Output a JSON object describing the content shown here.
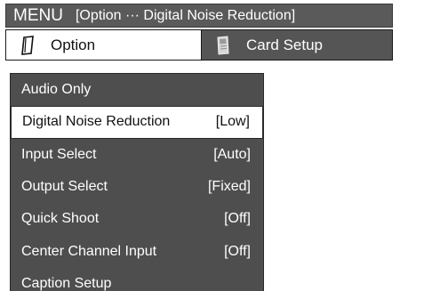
{
  "header": {
    "menu_label": "MENU",
    "breadcrumb": "[Option ··· Digital Noise Reduction]"
  },
  "tabs": [
    {
      "label": "Option",
      "icon": "option-icon",
      "active": true
    },
    {
      "label": "Card Setup",
      "icon": "card-icon",
      "active": false
    }
  ],
  "menu": {
    "items": [
      {
        "label": "Audio Only",
        "value": ""
      },
      {
        "label": "Digital Noise Reduction",
        "value": "[Low]",
        "selected": true
      },
      {
        "label": "Input Select",
        "value": "[Auto]"
      },
      {
        "label": "Output Select",
        "value": "[Fixed]"
      },
      {
        "label": "Quick Shoot",
        "value": "[Off]"
      },
      {
        "label": "Center Channel Input",
        "value": "[Off]"
      },
      {
        "label": "Caption Setup",
        "value": ""
      }
    ]
  },
  "colors": {
    "panel": "#4e4e4e",
    "header": "#5a5a5a",
    "selected_bg": "#ffffff"
  }
}
